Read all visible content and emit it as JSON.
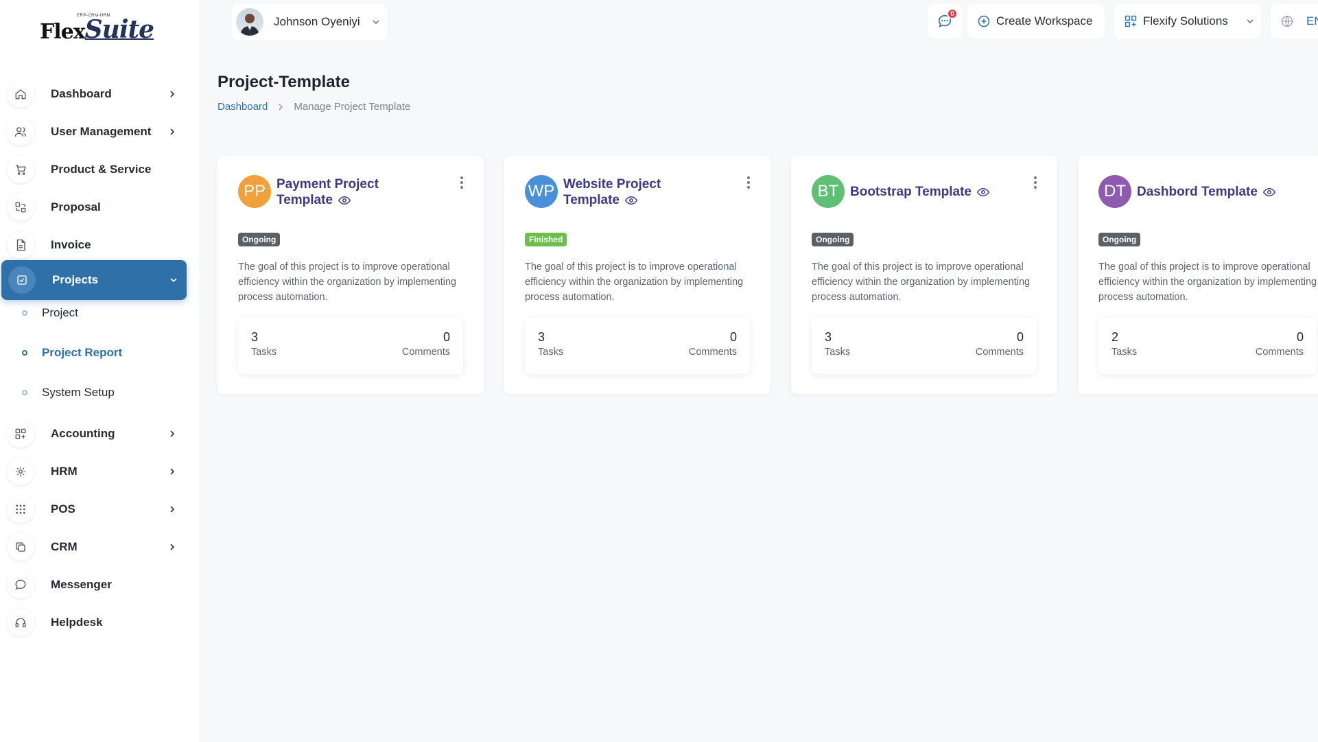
{
  "brand": {
    "logo_left": "Flex",
    "logo_right": "Suite",
    "logo_tagline": "ERP-CRM-HRM"
  },
  "user": {
    "name": "Johnson Oyeniyi"
  },
  "topbar": {
    "messages_count": "0",
    "create_workspace": "Create Workspace",
    "company": "Flexify Solutions",
    "language": "EN"
  },
  "sidebar": {
    "items": [
      {
        "label": "Dashboard",
        "icon": "home-icon"
      },
      {
        "label": "User Management",
        "icon": "users-icon"
      },
      {
        "label": "Product & Service",
        "icon": "cart-icon"
      },
      {
        "label": "Proposal",
        "icon": "proposal-icon"
      },
      {
        "label": "Invoice",
        "icon": "invoice-icon"
      },
      {
        "label": "Projects",
        "icon": "checkbox-icon"
      },
      {
        "label": "Accounting",
        "icon": "grid-plus-icon"
      },
      {
        "label": "HRM",
        "icon": "hrm-icon"
      },
      {
        "label": "POS",
        "icon": "dots-grid-icon"
      },
      {
        "label": "CRM",
        "icon": "copy-icon"
      },
      {
        "label": "Messenger",
        "icon": "chat-icon"
      },
      {
        "label": "Helpdesk",
        "icon": "headset-icon"
      }
    ],
    "project_sub": [
      "Project",
      "Project Report",
      "System Setup"
    ]
  },
  "page": {
    "title": "Project-Template",
    "breadcrumb_root": "Dashboard",
    "breadcrumb_current": "Manage Project Template"
  },
  "cards": [
    {
      "initials": "PP",
      "color": "#f0a03c",
      "title": "Payment Project Template",
      "status": "Ongoing",
      "description": "The goal of this project is to improve operational efficiency within the organization by implementing process automation.",
      "tasks": "3",
      "tasks_label": "Tasks",
      "comments": "0",
      "comments_label": "Comments"
    },
    {
      "initials": "WP",
      "color": "#4a90d9",
      "title": "Website Project Template",
      "status": "Finished",
      "description": "The goal of this project is to improve operational efficiency within the organization by implementing process automation.",
      "tasks": "3",
      "tasks_label": "Tasks",
      "comments": "0",
      "comments_label": "Comments"
    },
    {
      "initials": "BT",
      "color": "#5fbf74",
      "title": "Bootstrap Template",
      "status": "Ongoing",
      "description": "The goal of this project is to improve operational efficiency within the organization by implementing process automation.",
      "tasks": "3",
      "tasks_label": "Tasks",
      "comments": "0",
      "comments_label": "Comments"
    },
    {
      "initials": "DT",
      "color": "#8e5bb0",
      "title": "Dashbord Template",
      "status": "Ongoing",
      "description": "The goal of this project is to improve operational efficiency within the organization by implementing process automation.",
      "tasks": "2",
      "tasks_label": "Tasks",
      "comments": "0",
      "comments_label": "Comments"
    }
  ]
}
